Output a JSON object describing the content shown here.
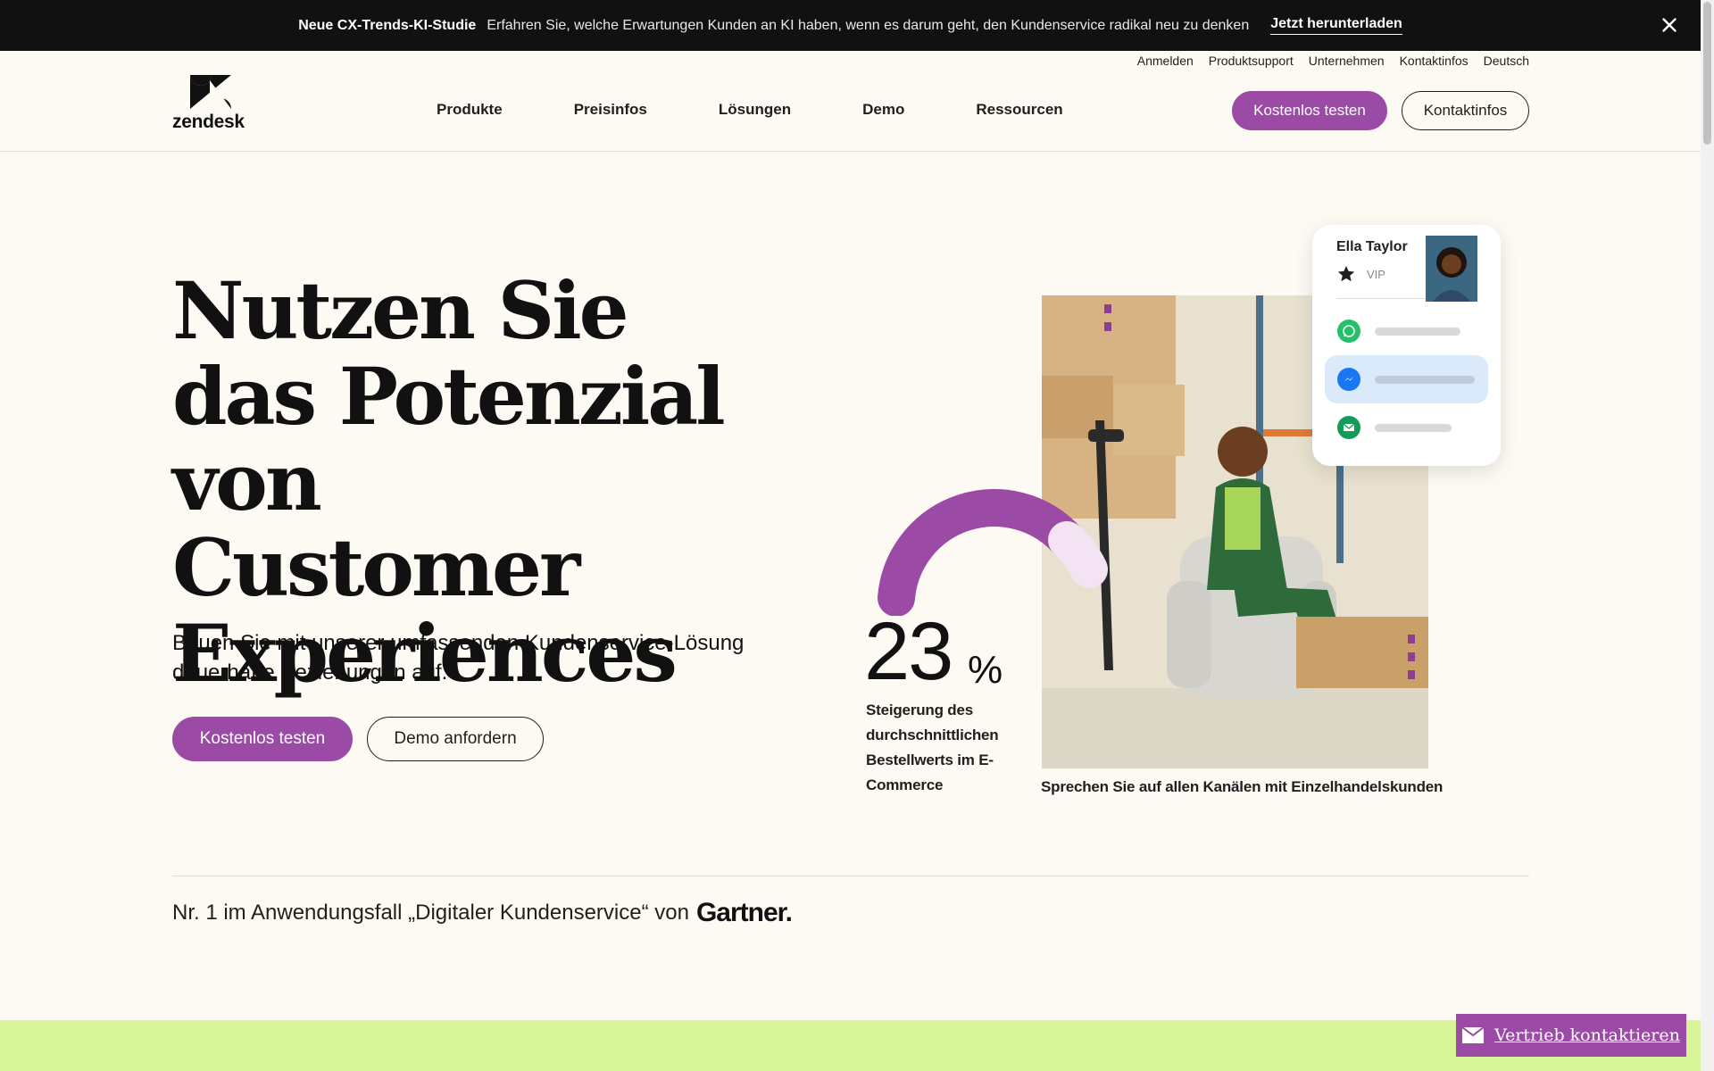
{
  "promo": {
    "title": "Neue CX-Trends-KI-Studie",
    "message": "Erfahren Sie, welche Erwartungen Kunden an KI haben, wenn es darum geht, den Kundenservice radikal neu zu denken",
    "cta": "Jetzt herunterladen"
  },
  "utility_nav": [
    "Anmelden",
    "Produktsupport",
    "Unternehmen",
    "Kontaktinfos",
    "Deutsch"
  ],
  "brand": {
    "name": "zendesk"
  },
  "nav": [
    "Produkte",
    "Preisinfos",
    "Lösungen",
    "Demo",
    "Ressourcen"
  ],
  "header_buttons": {
    "try": "Kostenlos testen",
    "contact": "Kontaktinfos"
  },
  "hero": {
    "title": "Nutzen Sie das Potenzial von Customer Experiences",
    "subtitle": "Bauen Sie mit unserer umfassenden Kundenservice-Lösung dauerhafte Beziehungen auf.",
    "primary_cta": "Kostenlos testen",
    "secondary_cta": "Demo anfordern"
  },
  "stat": {
    "value": "23",
    "unit": "%",
    "label": "Steigerung des durchschnittlichen Bestellwerts im E-Commerce"
  },
  "photo_caption": "Sprechen Sie auf allen Kanälen mit Einzelhandelskunden",
  "profile_card": {
    "name": "Ella Taylor",
    "tier": "VIP",
    "channels": [
      "whatsapp-icon",
      "messenger-icon",
      "email-icon"
    ],
    "selected_channel": 1
  },
  "ranking": {
    "text": "Nr. 1 im Anwendungsfall „Digitaler Kundenservice“ von",
    "brand": "Gartner."
  },
  "floating_cta": "Vertrieb kontaktieren",
  "colors": {
    "accent": "#9b4aa6",
    "band": "#d9f59a",
    "dark": "#111111"
  }
}
